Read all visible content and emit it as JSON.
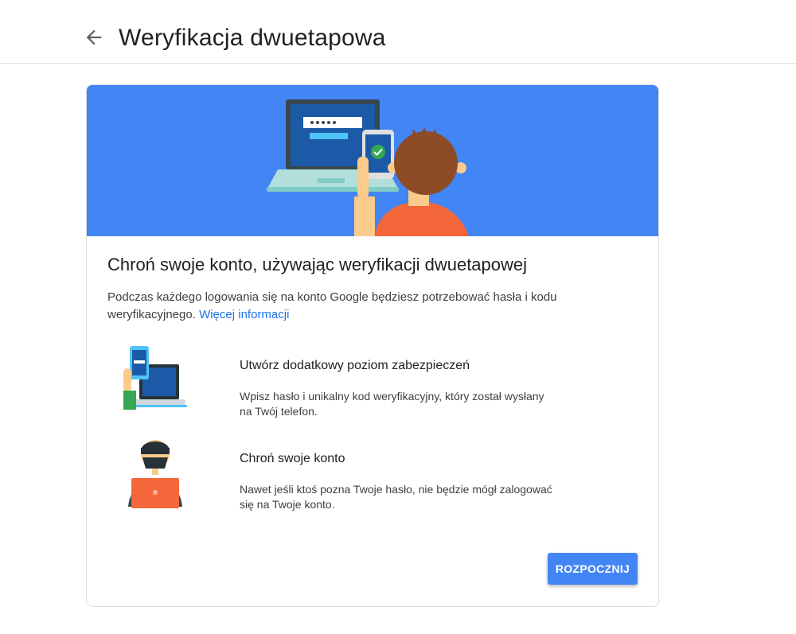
{
  "header": {
    "back_icon": "arrow-left-icon",
    "title": "Weryfikacja dwuetapowa"
  },
  "card": {
    "hero_illustration": "laptop-phone-person-illustration",
    "title": "Chroń swoje konto, używając weryfikacji dwuetapowej",
    "description_text": "Podczas każdego logowania się na konto Google będziesz potrzebować hasła i kodu weryfikacyjnego.",
    "learn_more_link": "Więcej informacji",
    "features": [
      {
        "illustration": "phone-laptop-code-illustration",
        "title": "Utwórz dodatkowy poziom zabezpieczeń",
        "text": "Wpisz hasło i unikalny kod weryfikacyjny, który został wysłany na Twój telefon."
      },
      {
        "illustration": "hacker-laptop-illustration",
        "title": "Chroń swoje konto",
        "text": "Nawet jeśli ktoś pozna Twoje hasło, nie będzie mógł zalogować się na Twoje konto."
      }
    ],
    "start_button": "ROZPOCZNIJ"
  },
  "colors": {
    "accent": "#4285f4",
    "link": "#1a73e8",
    "person_shirt": "#f4673b",
    "skin": "#fbcb8b"
  }
}
